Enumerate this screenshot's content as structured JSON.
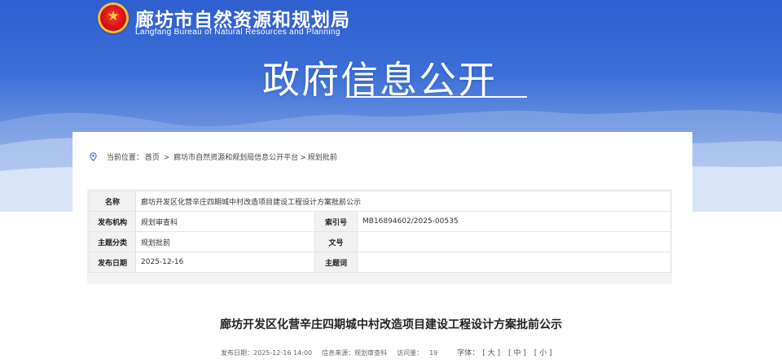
{
  "header": {
    "org_name_cn": "廊坊市自然资源和规划局",
    "org_name_en": "Langfang Bureau of Natural Resources and Planning",
    "emblem_icon": "national-emblem-icon",
    "page_banner_title": "政府信息公开"
  },
  "breadcrumb": {
    "prefix": "当前位置：",
    "home": "首页",
    "sep1": " > ",
    "platform": "廊坊市自然资源和规划局信息公开平台",
    "sep2": ">",
    "current": "规划批前"
  },
  "meta_table": {
    "name_label": "名称",
    "name_value": "廊坊开发区化营辛庄四期城中村改造项目建设工程设计方案批前公示",
    "publisher_label": "发布机构",
    "publisher_value": "规划审查科",
    "index_label": "索引号",
    "index_value": "MB16894602/2025-00535",
    "category_label": "主题分类",
    "category_value": "规划批前",
    "docno_label": "文号",
    "docno_value": "",
    "date_label": "发布日期",
    "date_value": "2025-12-16",
    "keywords_label": "主题词",
    "keywords_value": ""
  },
  "article": {
    "title": "廊坊开发区化营辛庄四期城中村改造项目建设工程设计方案批前公示",
    "publish_date_label": "发布日期：",
    "publish_date": "2025-12-16 14:00",
    "source_label": "信息来源：",
    "source": "规划审查科",
    "views_label": "访问量：",
    "views": "19",
    "font_label": "字体：",
    "font_large": "[ 大 ]",
    "font_medium": "[ 中 ]",
    "font_small": "[ 小 ]"
  },
  "colors": {
    "banner_top": "#2f5fcf",
    "banner_bottom": "#e9eff9",
    "accent_icon": "#3a6ad5"
  }
}
